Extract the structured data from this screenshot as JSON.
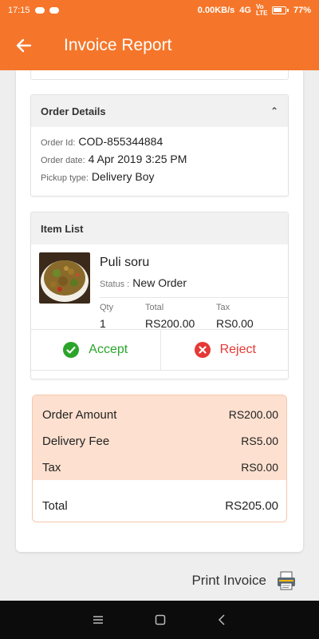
{
  "status_bar": {
    "time": "17:15",
    "network_speed": "0.00KB/s",
    "signal": "4G",
    "volte": "Vo LTE",
    "battery": "77%"
  },
  "app_bar": {
    "title": "Invoice Report",
    "back_icon": "arrow-left-icon",
    "color": "#f5762a"
  },
  "order_details": {
    "heading": "Order Details",
    "toggle_icon": "chevron-up-icon",
    "rows": [
      {
        "label": "Order Id:",
        "value": "COD-855344884"
      },
      {
        "label": "Order date:",
        "value": "4 Apr 2019 3:25 PM"
      },
      {
        "label": "Pickup type:",
        "value": "Delivery Boy"
      }
    ]
  },
  "item_list": {
    "heading": "Item List",
    "item": {
      "name": "Puli soru",
      "status_label": "Status :",
      "status": "New Order",
      "columns": [
        {
          "label": "Qty",
          "value": "1"
        },
        {
          "label": "Total",
          "value": "RS200.00"
        },
        {
          "label": "Tax",
          "value": "RS0.00"
        }
      ]
    },
    "accept_label": "Accept",
    "reject_label": "Reject",
    "accept_color": "#2aa52a",
    "reject_color": "#e53935"
  },
  "summary": {
    "rows": [
      {
        "label": "Order Amount",
        "value": "RS200.00"
      },
      {
        "label": "Delivery Fee",
        "value": "RS5.00"
      },
      {
        "label": "Tax",
        "value": "RS0.00"
      }
    ],
    "total_label": "Total",
    "total_value": "RS205.00",
    "accent_bg": "#fde0cf"
  },
  "print": {
    "label": "Print Invoice",
    "icon": "printer-icon"
  },
  "nav_bar": {
    "icons": [
      "menu-icon",
      "home-square-icon",
      "back-triangle-icon"
    ]
  }
}
